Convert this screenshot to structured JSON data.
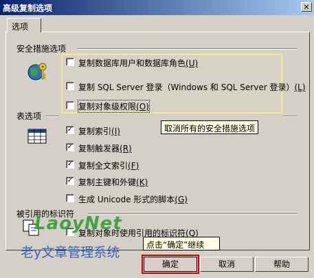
{
  "window": {
    "title": "高级复制选项",
    "close_icon": "close-icon"
  },
  "tab": {
    "label": "选项"
  },
  "security": {
    "header": "安全措施选项",
    "options": [
      {
        "label": "复制数据库用户和数据库角色",
        "key": "(U)",
        "checked": false
      },
      {
        "label": "复制 SQL Server 登录（Windows 和 SQL Server 登录）",
        "key": "(L)",
        "checked": false
      },
      {
        "label": "复制对象级权限",
        "key": "(O)",
        "checked": false
      }
    ]
  },
  "tooltip_security": "取消所有的安全措施选项",
  "table": {
    "header": "表选项",
    "options": [
      {
        "label": "复制索引",
        "key": "(I)",
        "checked": true
      },
      {
        "label": "复制触发器",
        "key": "(R)",
        "checked": true
      },
      {
        "label": "复制全文索引",
        "key": "(F)",
        "checked": true
      },
      {
        "label": "复制主键和外键",
        "key": "(K)",
        "checked": true
      },
      {
        "label": "生成 Unicode 形式的脚本",
        "key": "(G)",
        "checked": false
      }
    ]
  },
  "quoted": {
    "header": "被引用的标识符",
    "option": {
      "label": "复制对象时使用引用的标识符",
      "key": "(Q)",
      "checked": false
    }
  },
  "tooltip_ok": "点击“确定”继续",
  "watermark": {
    "brand": "LaoyNet",
    "text": "老y文章管理系统"
  },
  "buttons": {
    "ok": "确定",
    "cancel": "取消",
    "help": "帮助"
  }
}
